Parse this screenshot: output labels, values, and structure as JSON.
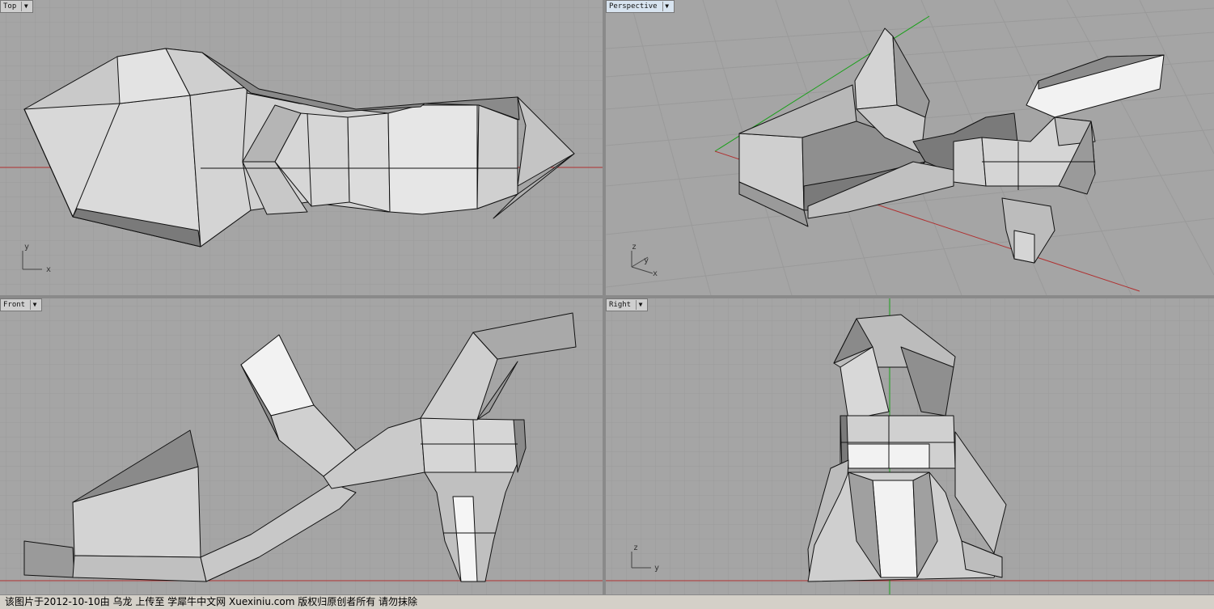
{
  "viewports": {
    "top": {
      "label": "Top"
    },
    "perspective": {
      "label": "Perspective"
    },
    "front": {
      "label": "Front"
    },
    "right": {
      "label": "Right"
    }
  },
  "axes": {
    "x": "x",
    "y": "y",
    "z": "z"
  },
  "status_text": "该图片于2012-10-10由 乌龙 上传至 学犀牛中文网 Xuexiniu.com 版权归原创者所有 请勿抹除",
  "colors": {
    "viewport_bg": "#a5a5a5",
    "grid_minor": "#999999",
    "grid_major": "#8d8d8d",
    "x_axis": "#b03030",
    "y_axis": "#1aa01a",
    "face_light": "#d9d9d9",
    "face_mid": "#b8b8b8",
    "face_dark": "#7a7a7a",
    "face_white": "#f5f5f5"
  }
}
